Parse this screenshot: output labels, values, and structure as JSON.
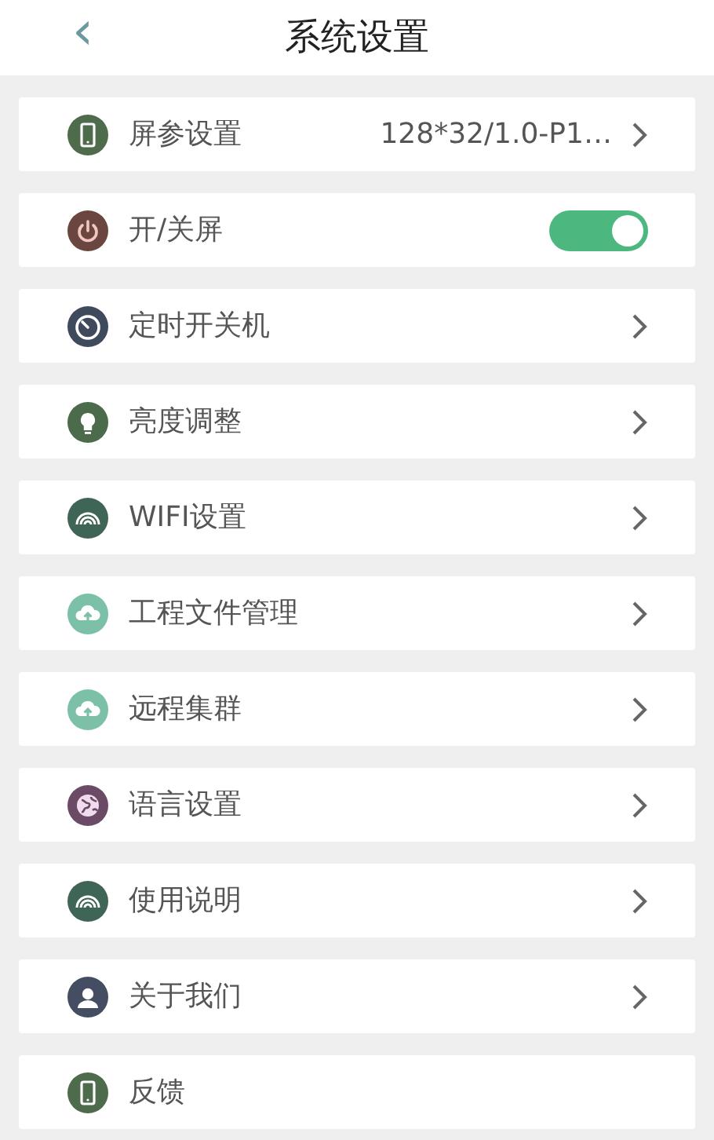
{
  "header": {
    "back": "‹",
    "title": "系统设置"
  },
  "items": [
    {
      "label": "屏参设置",
      "kind": "value",
      "value": "128*32/1.0-P1…",
      "color": "#4e6b4c"
    },
    {
      "label": "开/关屏",
      "kind": "toggle",
      "on": true,
      "color": "#6b4640"
    },
    {
      "label": "定时开关机",
      "kind": "link",
      "color": "#3f4a5c"
    },
    {
      "label": "亮度调整",
      "kind": "link",
      "color": "#4b6b4b"
    },
    {
      "label": "WIFI设置",
      "kind": "link",
      "color": "#3f6556"
    },
    {
      "label": "工程文件管理",
      "kind": "link",
      "color": "#7cc0a8"
    },
    {
      "label": "远程集群",
      "kind": "link",
      "color": "#7cc0a8"
    },
    {
      "label": "语言设置",
      "kind": "link",
      "color": "#6b4a66"
    },
    {
      "label": "使用说明",
      "kind": "link",
      "color": "#3f6556"
    },
    {
      "label": "关于我们",
      "kind": "link",
      "color": "#454d63"
    },
    {
      "label": "反馈",
      "kind": "plain",
      "color": "#4e6b4c"
    }
  ]
}
